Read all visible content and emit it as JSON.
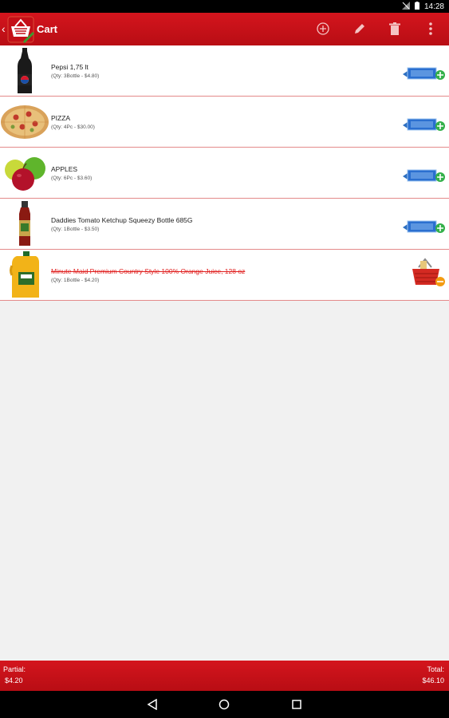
{
  "status_bar": {
    "time": "14:28",
    "icons": [
      "signal-off-icon",
      "battery-icon"
    ]
  },
  "app_bar": {
    "title": "Cart",
    "logo_icon": "basket-logo-icon",
    "actions": [
      "add-circle-icon",
      "pencil-icon",
      "trash-icon",
      "more-vertical-icon"
    ]
  },
  "items": [
    {
      "name": "Pepsi 1,75 lt",
      "qty": "(Qty: 3Bottle - $4.80)",
      "thumb": "pepsi-bottle-icon",
      "action": "add-to-cart-icon",
      "struck": false
    },
    {
      "name": "PIZZA",
      "qty": "(Qty: 4Pc - $30.00)",
      "thumb": "pizza-icon",
      "action": "add-to-cart-icon",
      "struck": false
    },
    {
      "name": "APPLES",
      "qty": "(Qty: 6Pc - $3.60)",
      "thumb": "apples-icon",
      "action": "add-to-cart-icon",
      "struck": false
    },
    {
      "name": "Daddies Tomato Ketchup Squeezy Bottle 685G",
      "qty": "(Qty: 1Bottle - $3.50)",
      "thumb": "ketchup-bottle-icon",
      "action": "add-to-cart-icon",
      "struck": false
    },
    {
      "name": "Minute Maid Premium Country Style 100% Orange Juice, 128 oz",
      "qty": "(Qty: 1Bottle - $4.20)",
      "thumb": "orange-juice-jug-icon",
      "action": "remove-from-basket-icon",
      "struck": true
    }
  ],
  "footer": {
    "partial_label": "Partial:",
    "partial_value": "$4.20",
    "total_label": "Total:",
    "total_value": "$46.10"
  },
  "nav": [
    "back-triangle-icon",
    "home-circle-icon",
    "recents-square-icon"
  ],
  "colors": {
    "brand_red": "#c8111a",
    "divider": "#e48a8a",
    "struck_text": "#e0201f"
  }
}
